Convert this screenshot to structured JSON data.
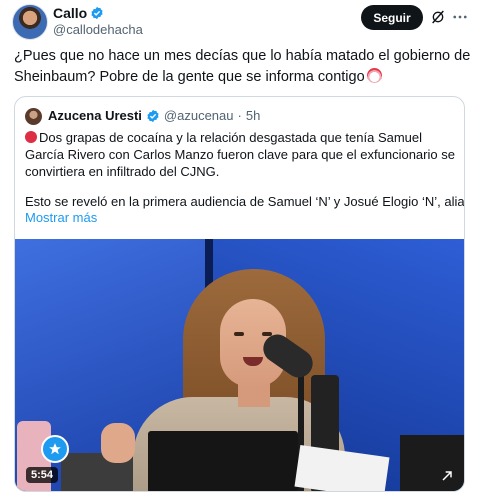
{
  "author": {
    "name": "Callo",
    "handle": "@callodehacha"
  },
  "follow_button": "Seguir",
  "post_text": "¿Pues que no hace un mes decías que lo había matado el gobierno de Sheinbaum? Pobre de la gente que se informa contigo",
  "quote": {
    "name": "Azucena Uresti",
    "handle": "@azucenau",
    "separator": "·",
    "time": "5h",
    "text": "Dos grapas de cocaína y la relación desgastada que tenía Samuel García Rivero con Carlos Manzo fueron clave para que el exfuncionario se convirtiera en infiltrado del CJNG.",
    "text2": "Esto se reveló en la primera audiencia de Samuel ‘N’ y Josué Elogio ‘N’, alias …",
    "show_more": "Mostrar más"
  },
  "video": {
    "duration": "5:54"
  },
  "colors": {
    "accent": "#1d9bf0",
    "verified": "#1d9bf0",
    "text": "#0f1419",
    "secondary": "#536471"
  },
  "icons": [
    "verified-badge-icon",
    "grok-icon",
    "more-icon",
    "red-circle-emoji",
    "clown-emoji",
    "channel-logo-icon",
    "external-link-icon"
  ]
}
